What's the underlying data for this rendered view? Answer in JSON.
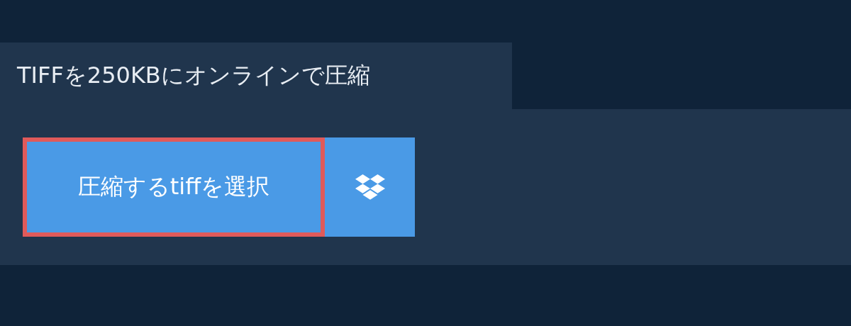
{
  "tab": {
    "title": "TIFFを250KBにオンラインで圧縮"
  },
  "upload": {
    "label": "圧縮するtiffを選択",
    "focused": true
  }
}
